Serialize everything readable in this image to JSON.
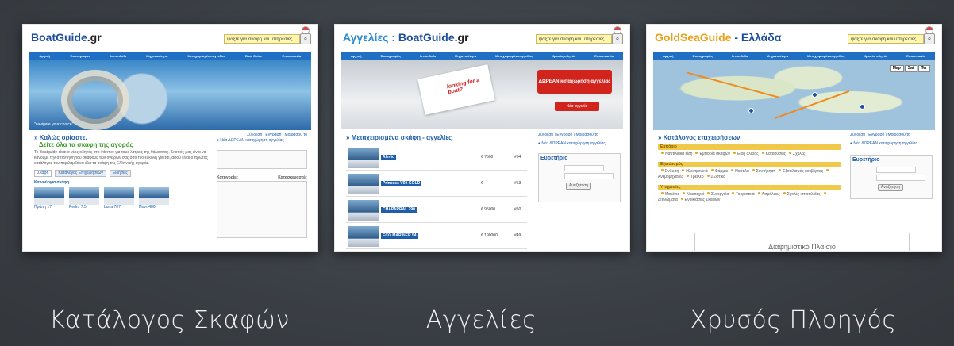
{
  "captions": [
    "Κατάλογος Σκαφών",
    "Αγγελίες",
    "Χρυσός Πλοηγός"
  ],
  "thumb1": {
    "logo_main": "BoatGuide",
    "logo_ext": ".gr",
    "search_placeholder": "ψάξτε για σκάφη και υπηρεσίες",
    "nav": [
      "Αρχική",
      "Φωτογραφίες",
      "Ιστιοπλοΐα",
      "Μηχανοκίνητα",
      "Μεταχειρισμένα-αγγελίες",
      "Boat Guide",
      "Επικοινωνία"
    ],
    "hero_caption": "\"navigate your choice\"",
    "welcome_title": "» Καλώς ορίσατε.",
    "welcome_sub": "Δείτε όλα τα σκάφη της αγοράς",
    "welcome_text": "Το Boatguide είναι ο νέος οδηγός στο internet για τους λάτρεις της θάλασσας. Σκοπός μας είναι να κάνουμε την απάντηση του σκάφους των ονείρων σας όσο πιο εύκολη γίνεται, αφού είναι ο πρώτος κατάλογος του περιλαμβάνει όλα τα σκάφη της Ελληνικής αγοράς.",
    "tabs": [
      "Σκάφη",
      "Κατάλογος Επιχειρήσεων",
      "Ειδήσεις"
    ],
    "new_boats": "Καινούργια σκάφη",
    "login": "Σύνδεση | Εγγραφή | Μοιράσου το",
    "free_listing": "Νέα ΔΩΡΕΑΝ καταχώρηση αγγελίας",
    "categories_label": "Κατηγορίες",
    "builders_label": "Κατασκευαστές",
    "boat_items": [
      "Πρώτη 17",
      "Pedro 7.5",
      "Luna 707",
      "Ποντ 480"
    ]
  },
  "thumb2": {
    "logo_prefix": "Αγγελίες : ",
    "logo_main": "BoatGuide",
    "logo_ext": ".gr",
    "search_placeholder": "ψάξτε για σκάφη και υπηρεσίες",
    "nav": [
      "Αρχική",
      "Φωτογραφίες",
      "Ιστιοπλοΐα",
      "Μηχανοκίνητα",
      "Μεταχειρισμένα-αγγελίες",
      "Χρυσός οδηγός",
      "Επικοινωνία"
    ],
    "hero_looking": "looking for a boat?",
    "hero_free": "ΔΩΡΕΑΝ καταχώρηση αγγελίας",
    "hero_new": "Νέα αγγελία",
    "section_title": "» Μεταχειρισμένα σκάφη - αγγελίες",
    "login": "Σύνδεση | Εγγραφή | Μοιράσου το",
    "free_listing": "Νέα ΔΩΡΕΑΝ καταχώρηση αγγελίας",
    "index_label": "Ευρετήριο",
    "search_btn": "Αναζήτηση",
    "rows": [
      {
        "name": "Alevio",
        "price": "€ 7500",
        "num": "#54"
      },
      {
        "name": "Princess V60-GOLD",
        "price": "€ --",
        "num": "#53"
      },
      {
        "name": "CHAPARRAL 290",
        "price": "€ 95000",
        "num": "#50"
      },
      {
        "name": "ECO MARINER 54",
        "price": "€ 190000",
        "num": "#49"
      }
    ]
  },
  "thumb3": {
    "logo_main": "GoldSeaGuide",
    "logo_ext": " - Ελλάδα",
    "search_placeholder": "ψάξτε για σκάφη και υπηρεσίες",
    "nav": [
      "Αρχική",
      "Φωτογραφίες",
      "Ιστιοπλοΐα",
      "Μηχανοκίνητα",
      "Μεταχειρισμένα-αγγελίες",
      "Χρυσός οδηγός",
      "Επικοινωνία"
    ],
    "map_btns": [
      "Map",
      "Sat",
      "Ter"
    ],
    "section_title": "» Κατάλογος επιχειρήσεων",
    "login": "Σύνδεση | Εγγραφή | Μοιράσου το",
    "free_listing": "Νέα ΔΩΡΕΑΝ καταχώρηση αγγελίας",
    "index_label": "Ευρετήριο",
    "search_btn": "Αναζήτηση",
    "groups": [
      {
        "title": "Εμπόριο",
        "items": [
          "Ναυτιλιακά είδη",
          "Εμπορία σκαφών",
          "Είδη αλιείας",
          "Καταδύσεις",
          "Σχολές"
        ]
      },
      {
        "title": "Εξοπλισμός",
        "items": [
          "Ενδυση",
          "Ηλεκτρονικά",
          "Φάρμοι",
          "Ναύτιλα",
          "Συντήρηση",
          "Εξοπλισμός κουβέρτας",
          "Ανεμομηχανές",
          "Τρέιλερ",
          "Σωστικά"
        ]
      },
      {
        "title": "Υπηρεσίες",
        "items": [
          "Μαρίνες",
          "Ναυπηγοί",
          "Συνεργεία",
          "Τουριστικά",
          "Ασφάλειες",
          "Σχολές ιστιοπλοΐας",
          "Διπλώματα",
          "Ενοικιάσεις Σκαφών"
        ]
      }
    ],
    "ad_label": "Διαφημιστικό Πλαίσιο"
  }
}
